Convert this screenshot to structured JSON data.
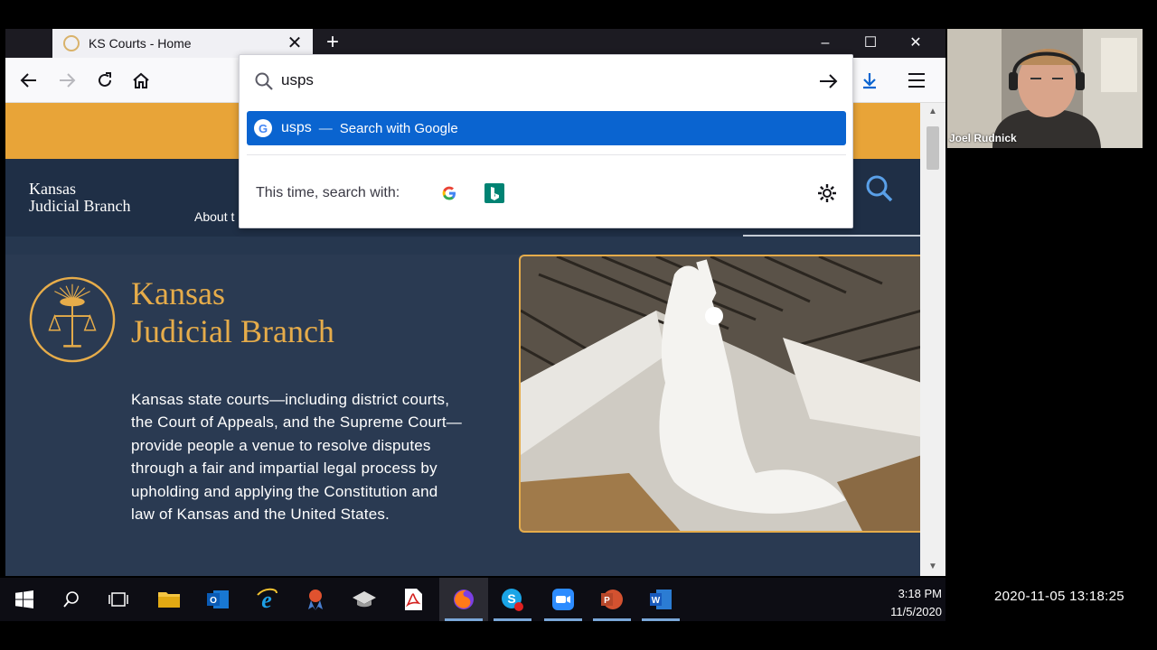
{
  "browser": {
    "tab_title": "KS Courts - Home",
    "tab_close_glyph": "✕",
    "new_tab_glyph": "+",
    "window_controls": {
      "minimize": "–",
      "maximize": "☐",
      "close": "✕"
    }
  },
  "urlbar": {
    "query": "usps",
    "suggestion": {
      "query": "usps",
      "separator": "—",
      "action": "Search with Google"
    },
    "one_time_label": "This time, search with:",
    "engines": [
      "google-icon",
      "bing-icon"
    ]
  },
  "page": {
    "logo_line1": "Kansas",
    "logo_line2": "Judicial Branch",
    "about_link": "About t",
    "hero_title_line1": "Kansas",
    "hero_title_line2": "Judicial Branch",
    "hero_text": "Kansas state courts—including district courts, the Court of Appeals, and the Supreme Court—provide people a venue to resolve disputes through a fair and impartial legal process by upholding and applying the Constitution and law of Kansas and the United States.",
    "accent_gold": "#e6ac4a",
    "header_bar_color": "#e8a438",
    "navy": "#26374f"
  },
  "webcam": {
    "name": "Joel Rudnick"
  },
  "taskbar": {
    "time": "3:18 PM",
    "date": "11/5/2020"
  },
  "timestamp": "2020-11-05 13:18:25"
}
